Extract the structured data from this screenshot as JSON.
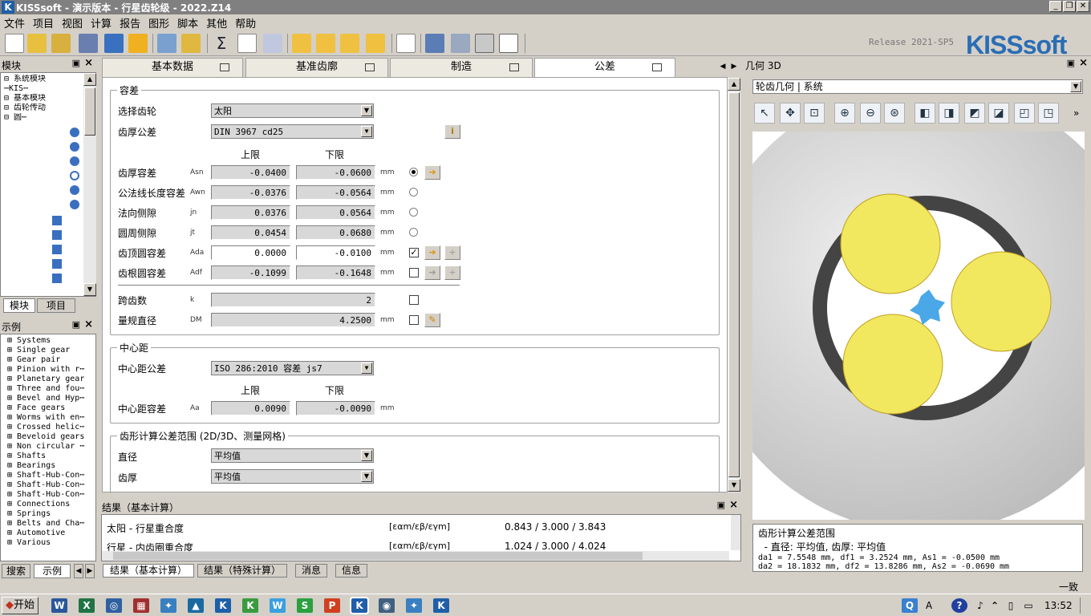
{
  "window": {
    "title": "KISSsoft - 演示版本 - 行星齿轮级 - 2022.Z14",
    "app_icon": "K"
  },
  "menu": [
    "文件",
    "项目",
    "视图",
    "计算",
    "报告",
    "图形",
    "脚本",
    "其他",
    "帮助"
  ],
  "release": "Release 2021-SP5",
  "logo": "KISSsoft",
  "modules": {
    "title": "模块",
    "tree": [
      "⊟ 系统模块",
      "     ⋯KIS⋯",
      "⊟ 基本模块",
      "   ⊟ 齿轮传动",
      "      ⊟ 圆⋯"
    ],
    "tabs": [
      "模块",
      "项目"
    ]
  },
  "examples": {
    "title": "示例",
    "items": [
      "Systems",
      "Single gear",
      "Gear pair",
      "Pinion with r⋯",
      "Planetary gear",
      "Three and fou⋯",
      "Bevel and Hyp⋯",
      "Face gears",
      "Worms with en⋯",
      "Crossed helic⋯",
      "Beveloid gears",
      "Non circular ⋯",
      "Shafts",
      "Bearings",
      "Shaft-Hub-Con⋯",
      "Shaft-Hub-Con⋯",
      "Shaft-Hub-Con⋯",
      "Connections",
      "Springs",
      "Belts and Cha⋯",
      "Automotive",
      "Various"
    ],
    "tabs": [
      "搜索",
      "示例"
    ]
  },
  "tabs": [
    "基本数据",
    "基准齿廓",
    "制造",
    "公差"
  ],
  "tol": {
    "group_title": "容差",
    "select_gear_label": "选择齿轮",
    "select_gear_value": "太阳",
    "tooth_tol_label": "齿厚公差",
    "tooth_tol_value": "DIN 3967 cd25",
    "upper": "上限",
    "lower": "下限",
    "rows": [
      {
        "label": "齿厚容差",
        "sym": "Asn",
        "up": "-0.0400",
        "lo": "-0.0600",
        "unit": "mm"
      },
      {
        "label": "公法线长度容差",
        "sym": "Awn",
        "up": "-0.0376",
        "lo": "-0.0564",
        "unit": "mm"
      },
      {
        "label": "法向侧隙",
        "sym": "jn",
        "up": "0.0376",
        "lo": "0.0564",
        "unit": "mm"
      },
      {
        "label": "圆周侧隙",
        "sym": "jt",
        "up": "0.0454",
        "lo": "0.0680",
        "unit": "mm"
      },
      {
        "label": "齿顶圆容差",
        "sym": "Ada",
        "up": "0.0000",
        "lo": "-0.0100",
        "unit": "mm"
      },
      {
        "label": "齿根圆容差",
        "sym": "Adf",
        "up": "-0.1099",
        "lo": "-0.1648",
        "unit": "mm"
      }
    ],
    "span_label": "跨齿数",
    "span_sym": "k",
    "span_value": "2",
    "ball_label": "量规直径",
    "ball_sym": "DM",
    "ball_value": "4.2500",
    "ball_unit": "mm"
  },
  "center": {
    "group_title": "中心距",
    "tol_label": "中心距公差",
    "tol_value": "ISO 286:2010 容差 js7",
    "upper": "上限",
    "lower": "下限",
    "dev_label": "中心距容差",
    "dev_sym": "Aa",
    "up": "0.0090",
    "lo": "-0.0090",
    "unit": "mm"
  },
  "flank": {
    "group_title": "齿形计算公差范围 (2D/3D、测量网格)",
    "dia_label": "直径",
    "dia_value": "平均值",
    "thick_label": "齿厚",
    "thick_value": "平均值"
  },
  "results": {
    "title": "结果（基本计算）",
    "rows": [
      {
        "name": "太阳 - 行星重合度",
        "sym": "[εαm/εβ/εγm]",
        "val": "0.843 / 3.000 / 3.843"
      },
      {
        "name": "行星 - 内齿圈重合度",
        "sym": "[εαm/εβ/εγm]",
        "val": "1.024 / 3.000 / 4.024"
      }
    ],
    "tabs": [
      "结果（基本计算）",
      "结果（特殊计算）",
      "消息",
      "信息"
    ]
  },
  "view3d": {
    "title": "几何 3D",
    "combo": "轮齿几何 | 系统"
  },
  "info": {
    "lines": [
      "齿形计算公差范围",
      "  - 直径: 平均值, 齿厚: 平均值",
      "da1 = 7.5548 mm, df1 = 3.2524 mm, As1 = -0.0500 mm",
      "da2 = 18.1832 mm, df2 = 13.8286 mm, As2 = -0.0690 mm"
    ]
  },
  "status": "一致",
  "taskbar": {
    "start": "开始",
    "clock": "13:52"
  }
}
